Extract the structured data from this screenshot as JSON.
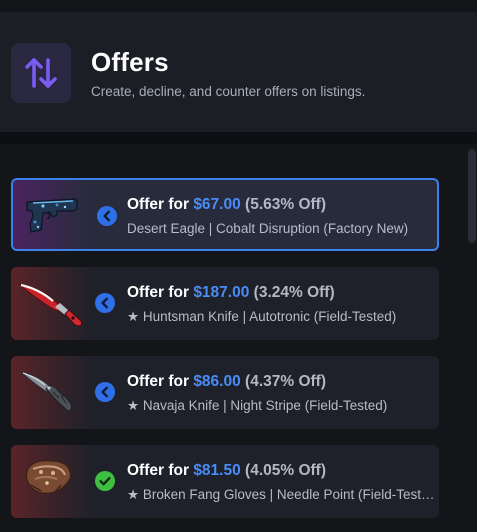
{
  "header": {
    "title": "Offers",
    "subtitle": "Create, decline, and counter offers on listings.",
    "icon": "sort-arrows-icon",
    "icon_color": "#7a5cf0"
  },
  "colors": {
    "accent": "#3c82ec",
    "price": "#4a8cf7",
    "status_pending": "#2f6fe8",
    "status_accepted": "#3fbf3f"
  },
  "offers": [
    {
      "prefix": "Offer for",
      "price": "$67.00",
      "discount": "(5.63% Off)",
      "item": "Desert Eagle | Cobalt Disruption (Factory New)",
      "status_icon": "chevron-left-icon",
      "image": "desert-eagle-image",
      "selected": true
    },
    {
      "prefix": "Offer for",
      "price": "$187.00",
      "discount": "(3.24% Off)",
      "item": "★ Huntsman Knife | Autotronic (Field-Tested)",
      "status_icon": "chevron-left-icon",
      "image": "huntsman-knife-image",
      "selected": false
    },
    {
      "prefix": "Offer for",
      "price": "$86.00",
      "discount": "(4.37% Off)",
      "item": "★ Navaja Knife | Night Stripe (Field-Tested)",
      "status_icon": "chevron-left-icon",
      "image": "navaja-knife-image",
      "selected": false
    },
    {
      "prefix": "Offer for",
      "price": "$81.50",
      "discount": "(4.05% Off)",
      "item": "★ Broken Fang Gloves | Needle Point (Field-Tested)",
      "status_icon": "check-circle-icon",
      "image": "gloves-image",
      "selected": false
    }
  ]
}
